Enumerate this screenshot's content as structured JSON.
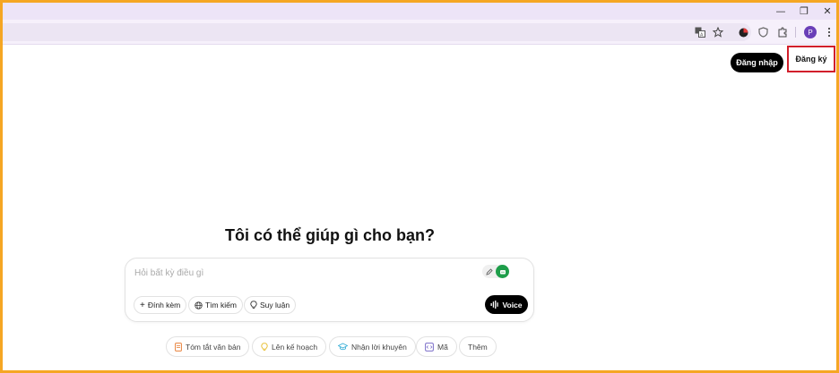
{
  "window": {
    "minimize": "—",
    "restore": "❐",
    "close": "✕"
  },
  "toolbar": {
    "profile_initial": "P",
    "icons": [
      "translate-icon",
      "star-icon",
      "extension-red-icon",
      "shield-icon",
      "puzzle-icon",
      "profile-avatar",
      "more-icon"
    ]
  },
  "header": {
    "login_label": "Đăng nhập",
    "signup_label": "Đăng ký"
  },
  "main": {
    "title": "Tôi có thể giúp gì cho bạn?",
    "composer": {
      "placeholder": "Hỏi bất kỳ điều gì",
      "attach_label": "Đính kèm",
      "search_label": "Tìm kiếm",
      "reason_label": "Suy luận",
      "voice_label": "Voice"
    },
    "suggestions": [
      {
        "label": "Tóm tắt văn bản",
        "icon": "document-icon",
        "color": "#e8813a"
      },
      {
        "label": "Lên kế hoạch",
        "icon": "lightbulb-icon",
        "color": "#e9c23d"
      },
      {
        "label": "Nhận lời khuyên",
        "icon": "graduation-cap-icon",
        "color": "#3ab0d8"
      },
      {
        "label": "Mã",
        "icon": "code-icon",
        "color": "#7c6fc9"
      },
      {
        "label": "Thêm",
        "icon": "",
        "color": ""
      }
    ]
  },
  "colors": {
    "frame": "#f5a623",
    "titlebar": "#ede4f7",
    "highlight": "#d21f2b"
  }
}
